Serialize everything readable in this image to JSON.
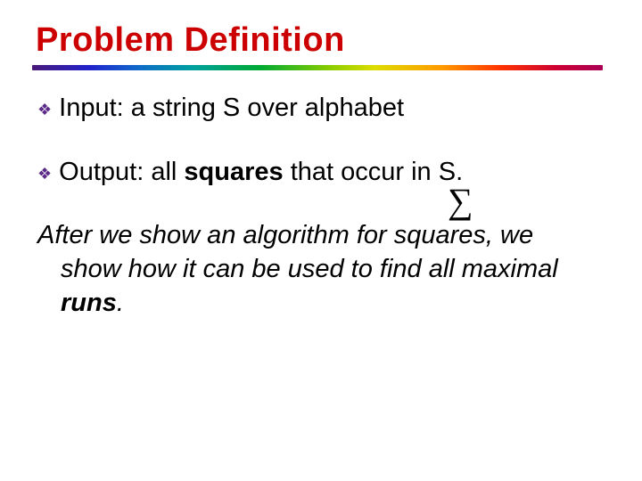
{
  "title": "Problem Definition",
  "bullets": [
    {
      "label": "Input:",
      "text": "a string S over alphabet"
    },
    {
      "label": "Output:",
      "pre": "all ",
      "bold": "squares",
      "post": " that occur in S."
    }
  ],
  "sigma_glyph": "∑",
  "paragraph": {
    "pre": "After we show an algorithm for squares, we show how it can be used to find all maximal ",
    "bold": "runs",
    "post": "."
  }
}
